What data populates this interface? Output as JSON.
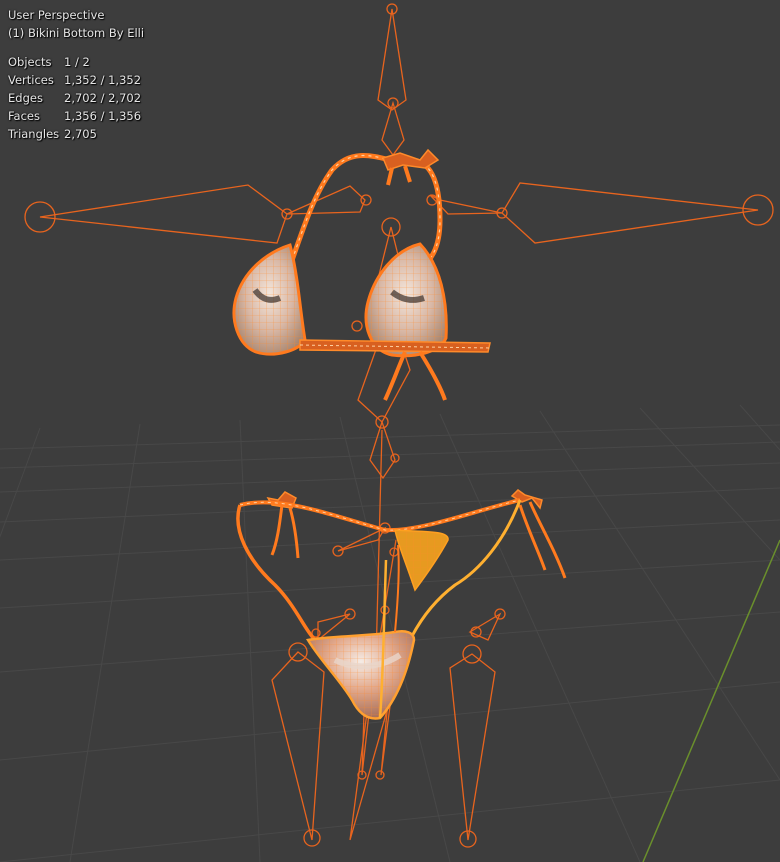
{
  "viewport": {
    "view_name": "User Perspective",
    "object_name": "(1) Bikini Bottom By Elli",
    "background_color": "#3d3d3d",
    "grid_color": "#484848",
    "y_axis_color": "#6a8f2c",
    "selection_color": "#e8641e",
    "active_color": "#ff9f2a"
  },
  "stats": {
    "rows": [
      {
        "label": "Objects",
        "value": "1 / 2"
      },
      {
        "label": "Vertices",
        "value": "1,352 / 1,352"
      },
      {
        "label": "Edges",
        "value": "2,702 / 2,702"
      },
      {
        "label": "Faces",
        "value": "1,356 / 1,356"
      },
      {
        "label": "Triangles",
        "value": "2,705"
      }
    ]
  }
}
